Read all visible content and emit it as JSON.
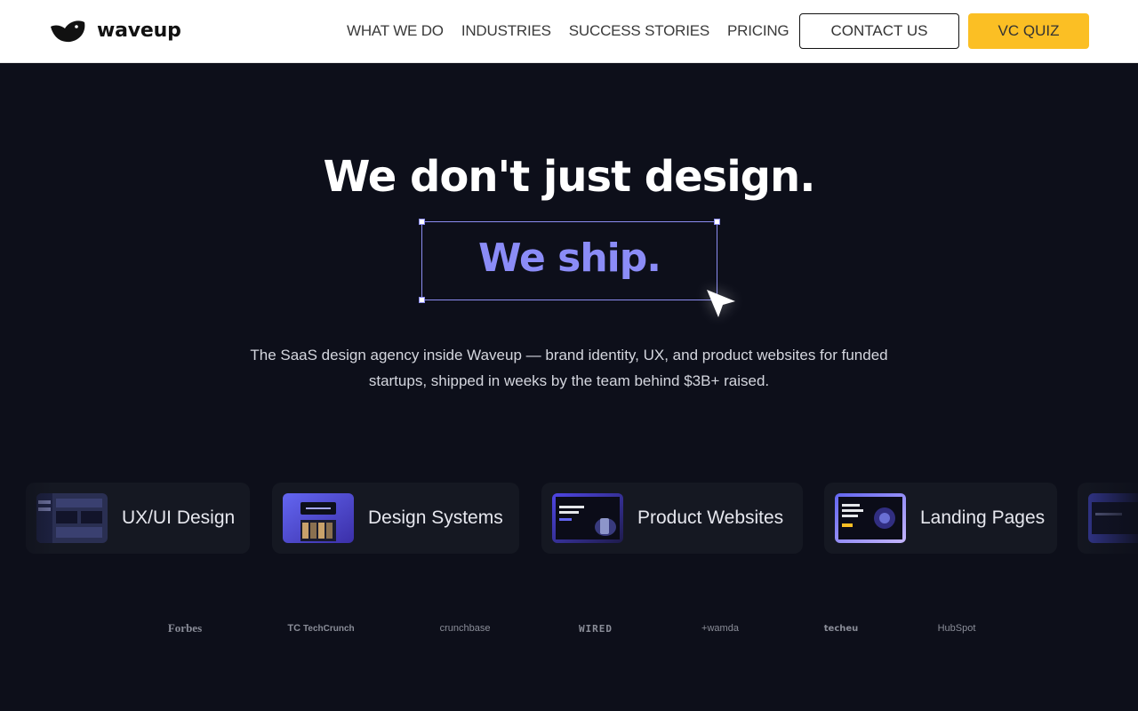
{
  "brand": {
    "name": "waveup",
    "accent": "#8b8cf7",
    "cta_color": "#fbbf24",
    "background": "#0d0f1a"
  },
  "nav": {
    "items": [
      {
        "label": "WHAT WE DO"
      },
      {
        "label": "INDUSTRIES"
      },
      {
        "label": "SUCCESS STORIES"
      },
      {
        "label": "PRICING"
      }
    ],
    "contact_label": "CONTACT US",
    "quiz_label": "VC QUIZ"
  },
  "hero": {
    "title": "We don't just design.",
    "highlight": "We ship.",
    "subtitle_line1": "The SaaS design agency inside Waveup — brand identity, UX, and product websites for funded",
    "subtitle_line2": "startups, shipped in weeks by the team behind $3B+ raised."
  },
  "services": [
    {
      "label": "UX/UI Design",
      "thumb": "dashboard-thumbnail"
    },
    {
      "label": "Design Systems",
      "thumb": "design-system-thumbnail"
    },
    {
      "label": "Product Websites",
      "thumb": "product-website-thumbnail"
    },
    {
      "label": "Landing Pages",
      "thumb": "landing-page-thumbnail"
    }
  ],
  "press": {
    "forbes": "Forbes",
    "techcrunch": "TechCrunch",
    "crunchbase": "crunchbase",
    "wired": "WIRED",
    "wamda": "wamda",
    "techeu_top": "tech",
    "techeu_bottom": "eu",
    "hubspot": "HubSpot"
  }
}
